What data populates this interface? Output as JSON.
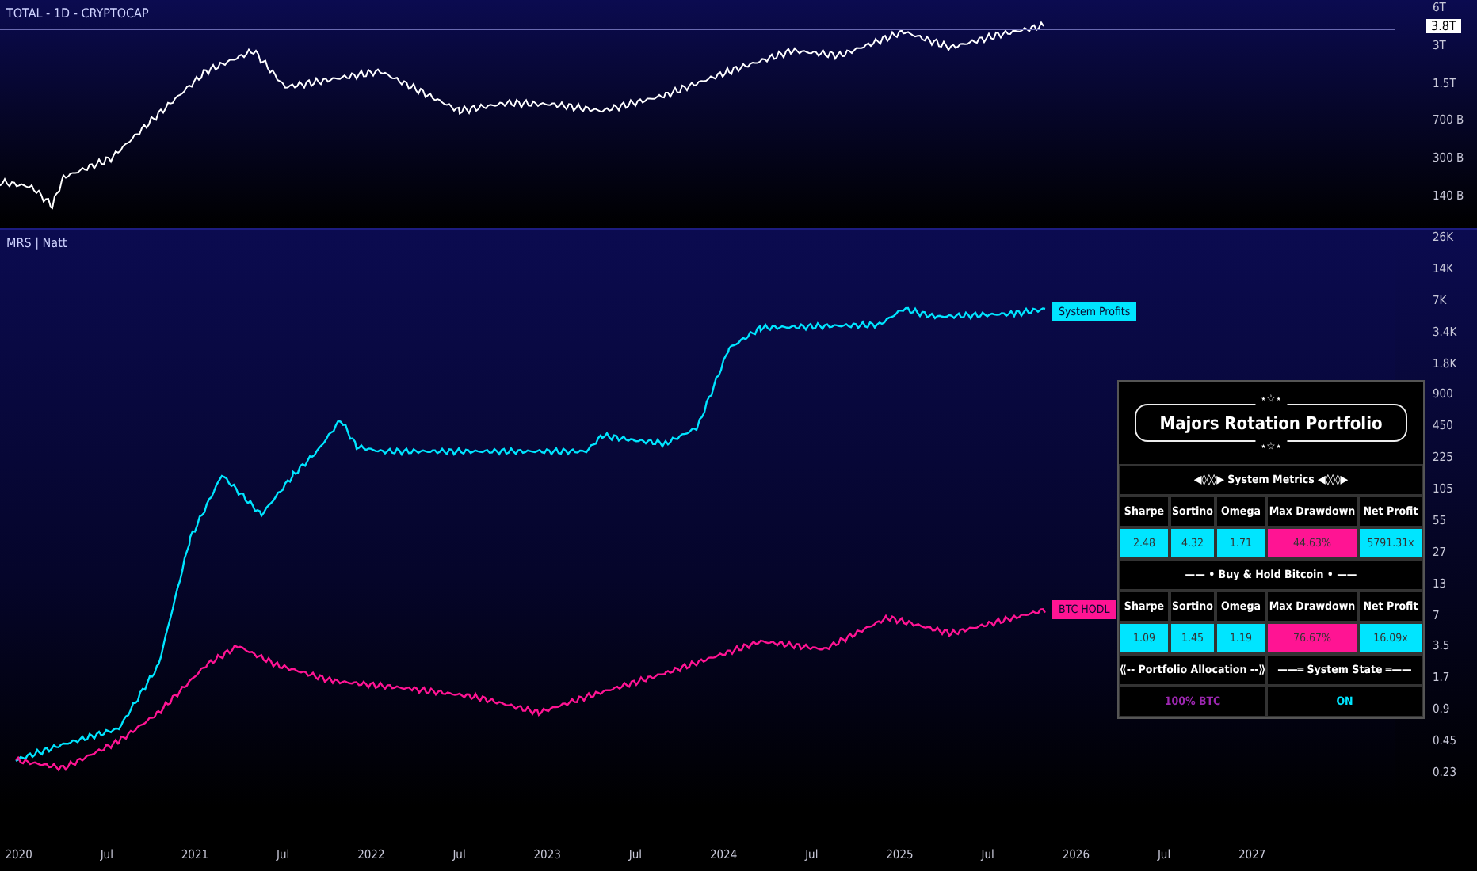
{
  "top_pane": {
    "title": "TOTAL - 1D - CRYPTOCAP",
    "price_tag": "3.8T",
    "price_axis": [
      "6T",
      "3T",
      "1.5T",
      "700 B",
      "300 B",
      "140 B"
    ]
  },
  "bottom_pane": {
    "title": "MRS | Natt",
    "price_axis": [
      "26K",
      "14K",
      "7K",
      "3.4K",
      "1.8K",
      "900",
      "450",
      "225",
      "105",
      "55",
      "27",
      "13",
      "7",
      "3.5",
      "1.7",
      "0.9",
      "0.45",
      "0.23"
    ],
    "series_labels": [
      {
        "text": "System Profits",
        "color": "#00e5ff"
      },
      {
        "text": "BTC HODL",
        "color": "#ff1493"
      }
    ]
  },
  "time_axis": [
    "2020",
    "Jul",
    "2021",
    "Jul",
    "2022",
    "Jul",
    "2023",
    "Jul",
    "2024",
    "Jul",
    "2025",
    "Jul",
    "2026",
    "Jul",
    "2027"
  ],
  "table": {
    "ornament_top": "⋆☆⋆",
    "title": "Majors Rotation Portfolio",
    "ornament_bottom": "⋆☆⋆",
    "sections": [
      {
        "heading": "◀◊◊◊▶ System Metrics ◀◊◊◊▶",
        "columns": [
          "Sharpe",
          "Sortino",
          "Omega",
          "Max Drawdown",
          "Net Profit"
        ],
        "values": [
          {
            "text": "2.48",
            "color": "#00e5ff"
          },
          {
            "text": "4.32",
            "color": "#00e5ff"
          },
          {
            "text": "1.71",
            "color": "#00e5ff"
          },
          {
            "text": "44.63%",
            "color": "#ff1493"
          },
          {
            "text": "5791.31x",
            "color": "#00e5ff"
          }
        ]
      },
      {
        "heading": "—— • Buy & Hold Bitcoin • ——",
        "columns": [
          "Sharpe",
          "Sortino",
          "Omega",
          "Max Drawdown",
          "Net Profit"
        ],
        "values": [
          {
            "text": "1.09",
            "color": "#00e5ff"
          },
          {
            "text": "1.45",
            "color": "#00e5ff"
          },
          {
            "text": "1.19",
            "color": "#00e5ff"
          },
          {
            "text": "76.67%",
            "color": "#ff1493"
          },
          {
            "text": "16.09x",
            "color": "#00e5ff"
          }
        ]
      }
    ],
    "status": [
      {
        "label": "⟪-- Portfolio Allocation --⟫",
        "value": "100% BTC",
        "color": "#9c27b0"
      },
      {
        "label": "——═ System State ═——",
        "value": "ON",
        "color": "#00e5ff"
      }
    ]
  }
}
